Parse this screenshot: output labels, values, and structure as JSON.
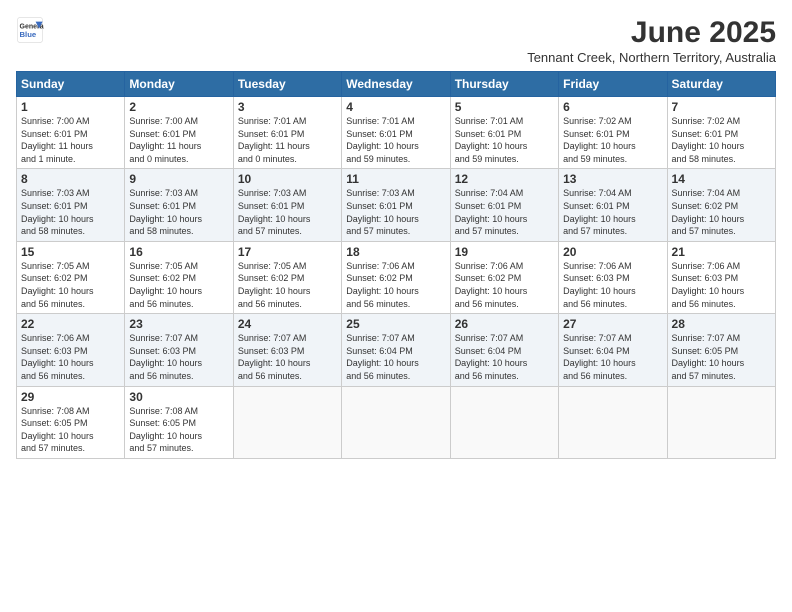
{
  "logo": {
    "general": "General",
    "blue": "Blue"
  },
  "title": "June 2025",
  "location": "Tennant Creek, Northern Territory, Australia",
  "days_of_week": [
    "Sunday",
    "Monday",
    "Tuesday",
    "Wednesday",
    "Thursday",
    "Friday",
    "Saturday"
  ],
  "weeks": [
    [
      {
        "day": "1",
        "info": "Sunrise: 7:00 AM\nSunset: 6:01 PM\nDaylight: 11 hours\nand 1 minute."
      },
      {
        "day": "2",
        "info": "Sunrise: 7:00 AM\nSunset: 6:01 PM\nDaylight: 11 hours\nand 0 minutes."
      },
      {
        "day": "3",
        "info": "Sunrise: 7:01 AM\nSunset: 6:01 PM\nDaylight: 11 hours\nand 0 minutes."
      },
      {
        "day": "4",
        "info": "Sunrise: 7:01 AM\nSunset: 6:01 PM\nDaylight: 10 hours\nand 59 minutes."
      },
      {
        "day": "5",
        "info": "Sunrise: 7:01 AM\nSunset: 6:01 PM\nDaylight: 10 hours\nand 59 minutes."
      },
      {
        "day": "6",
        "info": "Sunrise: 7:02 AM\nSunset: 6:01 PM\nDaylight: 10 hours\nand 59 minutes."
      },
      {
        "day": "7",
        "info": "Sunrise: 7:02 AM\nSunset: 6:01 PM\nDaylight: 10 hours\nand 58 minutes."
      }
    ],
    [
      {
        "day": "8",
        "info": "Sunrise: 7:03 AM\nSunset: 6:01 PM\nDaylight: 10 hours\nand 58 minutes."
      },
      {
        "day": "9",
        "info": "Sunrise: 7:03 AM\nSunset: 6:01 PM\nDaylight: 10 hours\nand 58 minutes."
      },
      {
        "day": "10",
        "info": "Sunrise: 7:03 AM\nSunset: 6:01 PM\nDaylight: 10 hours\nand 57 minutes."
      },
      {
        "day": "11",
        "info": "Sunrise: 7:03 AM\nSunset: 6:01 PM\nDaylight: 10 hours\nand 57 minutes."
      },
      {
        "day": "12",
        "info": "Sunrise: 7:04 AM\nSunset: 6:01 PM\nDaylight: 10 hours\nand 57 minutes."
      },
      {
        "day": "13",
        "info": "Sunrise: 7:04 AM\nSunset: 6:01 PM\nDaylight: 10 hours\nand 57 minutes."
      },
      {
        "day": "14",
        "info": "Sunrise: 7:04 AM\nSunset: 6:02 PM\nDaylight: 10 hours\nand 57 minutes."
      }
    ],
    [
      {
        "day": "15",
        "info": "Sunrise: 7:05 AM\nSunset: 6:02 PM\nDaylight: 10 hours\nand 56 minutes."
      },
      {
        "day": "16",
        "info": "Sunrise: 7:05 AM\nSunset: 6:02 PM\nDaylight: 10 hours\nand 56 minutes."
      },
      {
        "day": "17",
        "info": "Sunrise: 7:05 AM\nSunset: 6:02 PM\nDaylight: 10 hours\nand 56 minutes."
      },
      {
        "day": "18",
        "info": "Sunrise: 7:06 AM\nSunset: 6:02 PM\nDaylight: 10 hours\nand 56 minutes."
      },
      {
        "day": "19",
        "info": "Sunrise: 7:06 AM\nSunset: 6:02 PM\nDaylight: 10 hours\nand 56 minutes."
      },
      {
        "day": "20",
        "info": "Sunrise: 7:06 AM\nSunset: 6:03 PM\nDaylight: 10 hours\nand 56 minutes."
      },
      {
        "day": "21",
        "info": "Sunrise: 7:06 AM\nSunset: 6:03 PM\nDaylight: 10 hours\nand 56 minutes."
      }
    ],
    [
      {
        "day": "22",
        "info": "Sunrise: 7:06 AM\nSunset: 6:03 PM\nDaylight: 10 hours\nand 56 minutes."
      },
      {
        "day": "23",
        "info": "Sunrise: 7:07 AM\nSunset: 6:03 PM\nDaylight: 10 hours\nand 56 minutes."
      },
      {
        "day": "24",
        "info": "Sunrise: 7:07 AM\nSunset: 6:03 PM\nDaylight: 10 hours\nand 56 minutes."
      },
      {
        "day": "25",
        "info": "Sunrise: 7:07 AM\nSunset: 6:04 PM\nDaylight: 10 hours\nand 56 minutes."
      },
      {
        "day": "26",
        "info": "Sunrise: 7:07 AM\nSunset: 6:04 PM\nDaylight: 10 hours\nand 56 minutes."
      },
      {
        "day": "27",
        "info": "Sunrise: 7:07 AM\nSunset: 6:04 PM\nDaylight: 10 hours\nand 56 minutes."
      },
      {
        "day": "28",
        "info": "Sunrise: 7:07 AM\nSunset: 6:05 PM\nDaylight: 10 hours\nand 57 minutes."
      }
    ],
    [
      {
        "day": "29",
        "info": "Sunrise: 7:08 AM\nSunset: 6:05 PM\nDaylight: 10 hours\nand 57 minutes."
      },
      {
        "day": "30",
        "info": "Sunrise: 7:08 AM\nSunset: 6:05 PM\nDaylight: 10 hours\nand 57 minutes."
      },
      {
        "day": "",
        "info": ""
      },
      {
        "day": "",
        "info": ""
      },
      {
        "day": "",
        "info": ""
      },
      {
        "day": "",
        "info": ""
      },
      {
        "day": "",
        "info": ""
      }
    ]
  ]
}
